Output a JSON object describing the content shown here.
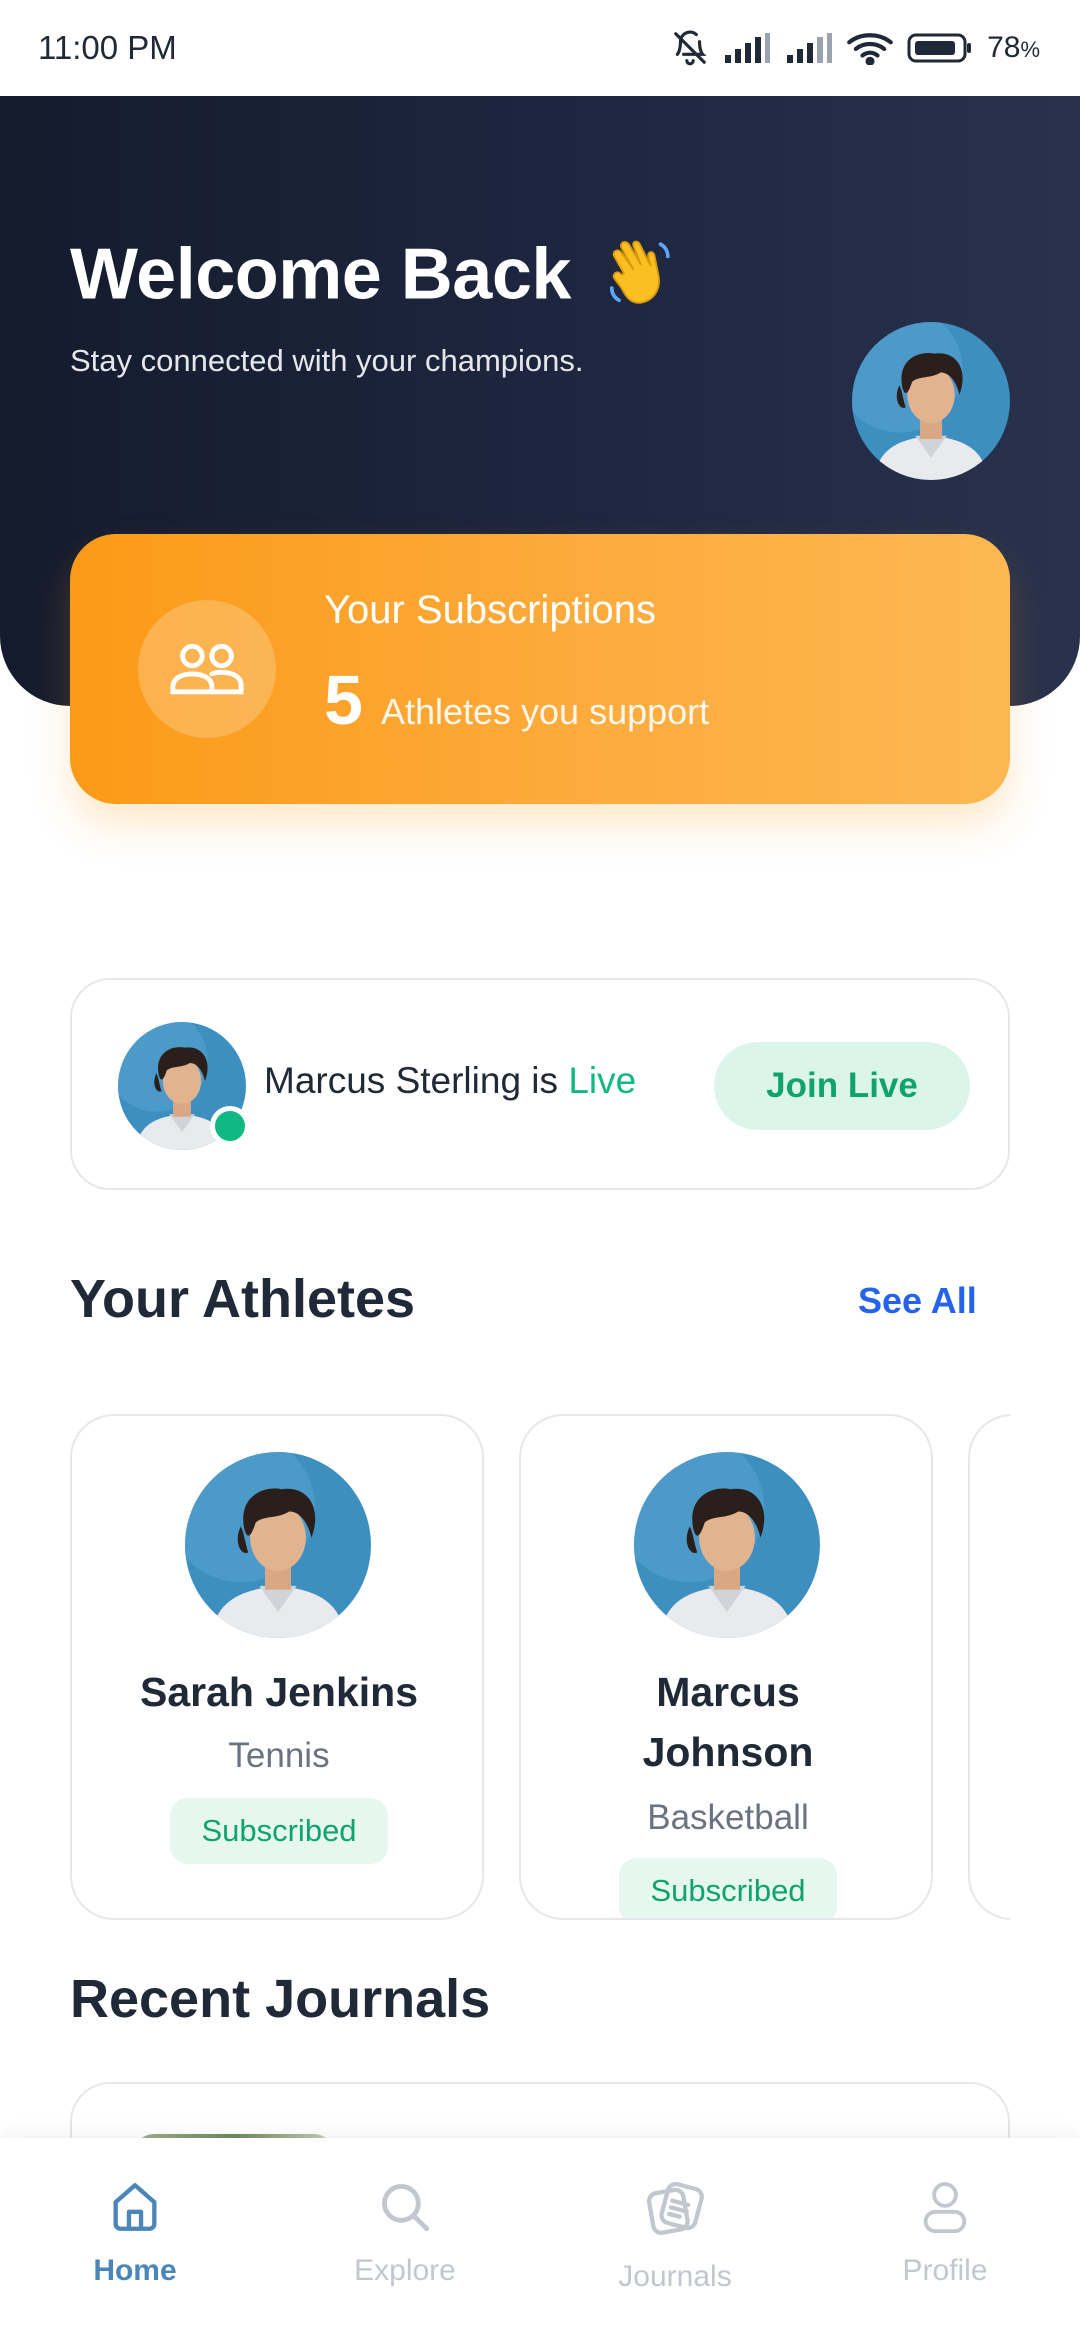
{
  "status_bar": {
    "time": "11:00 PM",
    "battery": "78",
    "battery_unit": "%",
    "icons": [
      "bell-off-icon",
      "signal-icon",
      "signal-icon",
      "wifi-icon",
      "battery-icon"
    ]
  },
  "hero": {
    "title": "Welcome Back",
    "title_emoji_icon": "waving-hand-icon",
    "subtitle": "Stay connected with your champions."
  },
  "subscriptions": {
    "title": "Your Subscriptions",
    "count": "5",
    "label": "Athletes you support",
    "icon": "users-icon"
  },
  "live": {
    "name_text": "Marcus Sterling is",
    "live_word": "Live",
    "button_label": "Join Live"
  },
  "athletes_section": {
    "title": "Your Athletes",
    "see_all": "See All",
    "items": [
      {
        "name": "Sarah Jenkins",
        "sport": "Tennis",
        "status": "Subscribed"
      },
      {
        "name": "Marcus Johnson",
        "sport": "Basketball",
        "status": "Subscribed"
      }
    ]
  },
  "journals_section": {
    "title": "Recent Journals"
  },
  "bottom_nav": {
    "items": [
      {
        "label": "Home",
        "icon": "home-icon",
        "active": true
      },
      {
        "label": "Explore",
        "icon": "search-icon",
        "active": false
      },
      {
        "label": "Journals",
        "icon": "journal-icon",
        "active": false
      },
      {
        "label": "Profile",
        "icon": "user-icon",
        "active": false
      }
    ]
  },
  "colors": {
    "hero_dark": "#1e2740",
    "accent_orange": "#fb9a17",
    "live_green": "#10b981",
    "link_blue": "#2563eb",
    "nav_active": "#4a86b8"
  }
}
